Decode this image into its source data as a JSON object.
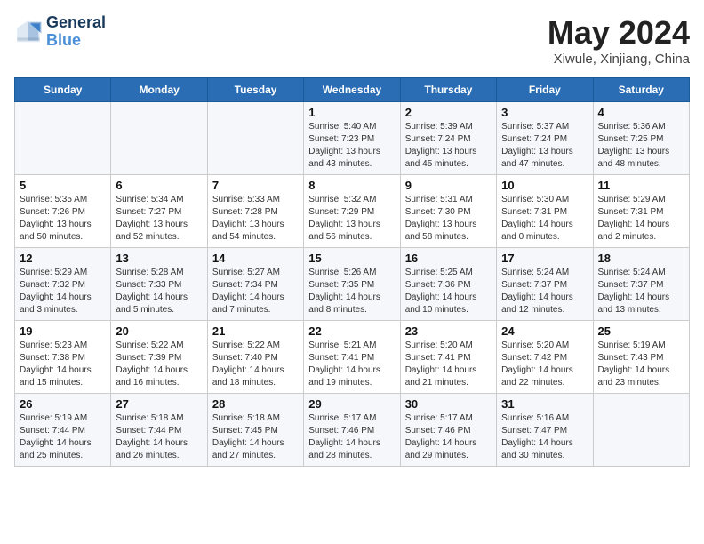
{
  "header": {
    "logo_line1": "General",
    "logo_line2": "Blue",
    "month": "May 2024",
    "location": "Xiwule, Xinjiang, China"
  },
  "days_of_week": [
    "Sunday",
    "Monday",
    "Tuesday",
    "Wednesday",
    "Thursday",
    "Friday",
    "Saturday"
  ],
  "weeks": [
    [
      {
        "day": "",
        "info": ""
      },
      {
        "day": "",
        "info": ""
      },
      {
        "day": "",
        "info": ""
      },
      {
        "day": "1",
        "info": "Sunrise: 5:40 AM\nSunset: 7:23 PM\nDaylight: 13 hours\nand 43 minutes."
      },
      {
        "day": "2",
        "info": "Sunrise: 5:39 AM\nSunset: 7:24 PM\nDaylight: 13 hours\nand 45 minutes."
      },
      {
        "day": "3",
        "info": "Sunrise: 5:37 AM\nSunset: 7:24 PM\nDaylight: 13 hours\nand 47 minutes."
      },
      {
        "day": "4",
        "info": "Sunrise: 5:36 AM\nSunset: 7:25 PM\nDaylight: 13 hours\nand 48 minutes."
      }
    ],
    [
      {
        "day": "5",
        "info": "Sunrise: 5:35 AM\nSunset: 7:26 PM\nDaylight: 13 hours\nand 50 minutes."
      },
      {
        "day": "6",
        "info": "Sunrise: 5:34 AM\nSunset: 7:27 PM\nDaylight: 13 hours\nand 52 minutes."
      },
      {
        "day": "7",
        "info": "Sunrise: 5:33 AM\nSunset: 7:28 PM\nDaylight: 13 hours\nand 54 minutes."
      },
      {
        "day": "8",
        "info": "Sunrise: 5:32 AM\nSunset: 7:29 PM\nDaylight: 13 hours\nand 56 minutes."
      },
      {
        "day": "9",
        "info": "Sunrise: 5:31 AM\nSunset: 7:30 PM\nDaylight: 13 hours\nand 58 minutes."
      },
      {
        "day": "10",
        "info": "Sunrise: 5:30 AM\nSunset: 7:31 PM\nDaylight: 14 hours\nand 0 minutes."
      },
      {
        "day": "11",
        "info": "Sunrise: 5:29 AM\nSunset: 7:31 PM\nDaylight: 14 hours\nand 2 minutes."
      }
    ],
    [
      {
        "day": "12",
        "info": "Sunrise: 5:29 AM\nSunset: 7:32 PM\nDaylight: 14 hours\nand 3 minutes."
      },
      {
        "day": "13",
        "info": "Sunrise: 5:28 AM\nSunset: 7:33 PM\nDaylight: 14 hours\nand 5 minutes."
      },
      {
        "day": "14",
        "info": "Sunrise: 5:27 AM\nSunset: 7:34 PM\nDaylight: 14 hours\nand 7 minutes."
      },
      {
        "day": "15",
        "info": "Sunrise: 5:26 AM\nSunset: 7:35 PM\nDaylight: 14 hours\nand 8 minutes."
      },
      {
        "day": "16",
        "info": "Sunrise: 5:25 AM\nSunset: 7:36 PM\nDaylight: 14 hours\nand 10 minutes."
      },
      {
        "day": "17",
        "info": "Sunrise: 5:24 AM\nSunset: 7:37 PM\nDaylight: 14 hours\nand 12 minutes."
      },
      {
        "day": "18",
        "info": "Sunrise: 5:24 AM\nSunset: 7:37 PM\nDaylight: 14 hours\nand 13 minutes."
      }
    ],
    [
      {
        "day": "19",
        "info": "Sunrise: 5:23 AM\nSunset: 7:38 PM\nDaylight: 14 hours\nand 15 minutes."
      },
      {
        "day": "20",
        "info": "Sunrise: 5:22 AM\nSunset: 7:39 PM\nDaylight: 14 hours\nand 16 minutes."
      },
      {
        "day": "21",
        "info": "Sunrise: 5:22 AM\nSunset: 7:40 PM\nDaylight: 14 hours\nand 18 minutes."
      },
      {
        "day": "22",
        "info": "Sunrise: 5:21 AM\nSunset: 7:41 PM\nDaylight: 14 hours\nand 19 minutes."
      },
      {
        "day": "23",
        "info": "Sunrise: 5:20 AM\nSunset: 7:41 PM\nDaylight: 14 hours\nand 21 minutes."
      },
      {
        "day": "24",
        "info": "Sunrise: 5:20 AM\nSunset: 7:42 PM\nDaylight: 14 hours\nand 22 minutes."
      },
      {
        "day": "25",
        "info": "Sunrise: 5:19 AM\nSunset: 7:43 PM\nDaylight: 14 hours\nand 23 minutes."
      }
    ],
    [
      {
        "day": "26",
        "info": "Sunrise: 5:19 AM\nSunset: 7:44 PM\nDaylight: 14 hours\nand 25 minutes."
      },
      {
        "day": "27",
        "info": "Sunrise: 5:18 AM\nSunset: 7:44 PM\nDaylight: 14 hours\nand 26 minutes."
      },
      {
        "day": "28",
        "info": "Sunrise: 5:18 AM\nSunset: 7:45 PM\nDaylight: 14 hours\nand 27 minutes."
      },
      {
        "day": "29",
        "info": "Sunrise: 5:17 AM\nSunset: 7:46 PM\nDaylight: 14 hours\nand 28 minutes."
      },
      {
        "day": "30",
        "info": "Sunrise: 5:17 AM\nSunset: 7:46 PM\nDaylight: 14 hours\nand 29 minutes."
      },
      {
        "day": "31",
        "info": "Sunrise: 5:16 AM\nSunset: 7:47 PM\nDaylight: 14 hours\nand 30 minutes."
      },
      {
        "day": "",
        "info": ""
      }
    ]
  ]
}
